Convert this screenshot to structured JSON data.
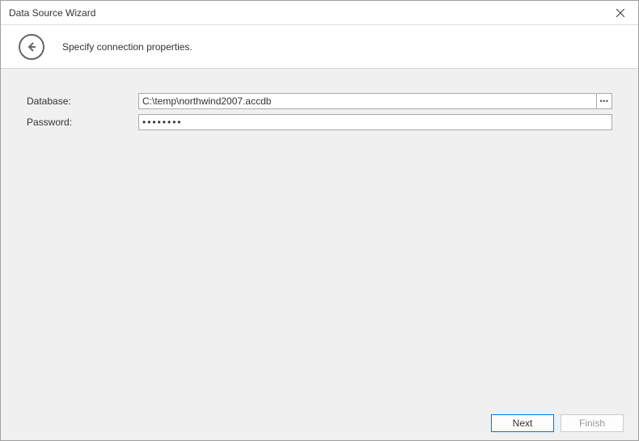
{
  "window": {
    "title": "Data Source Wizard"
  },
  "header": {
    "subtitle": "Specify connection properties."
  },
  "form": {
    "database": {
      "label": "Database:",
      "value": "C:\\temp\\northwind2007.accdb"
    },
    "password": {
      "label": "Password:",
      "value": "••••••••"
    }
  },
  "footer": {
    "next": "Next",
    "finish": "Finish"
  }
}
